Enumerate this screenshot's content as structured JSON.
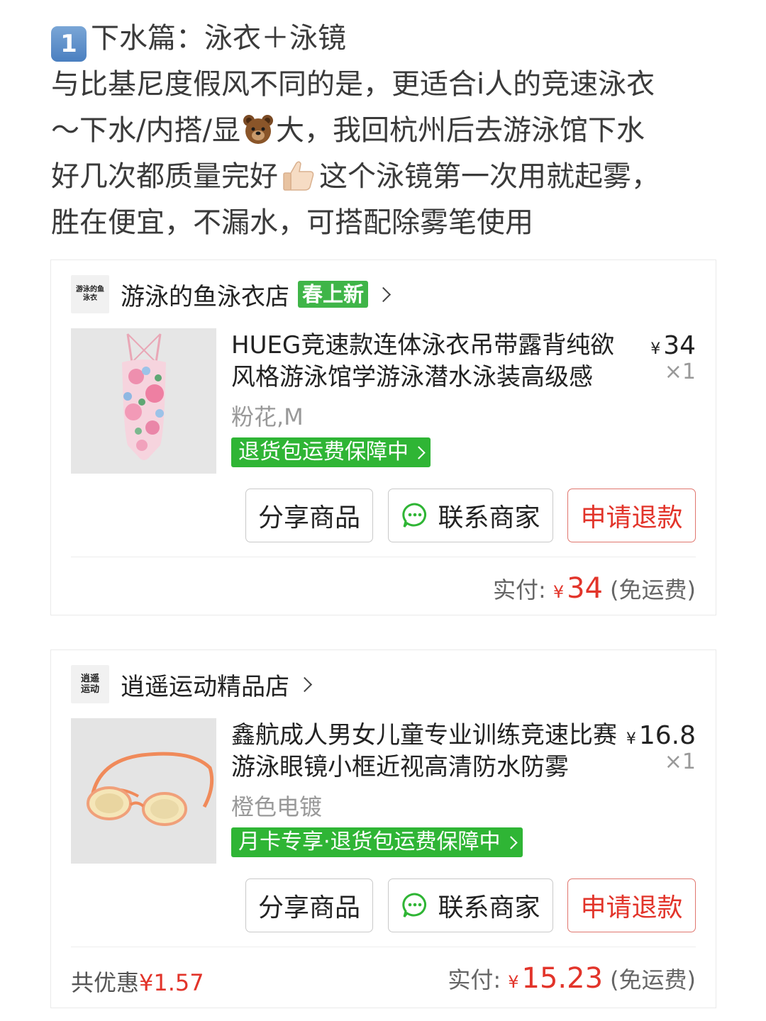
{
  "intro": {
    "badge": "1",
    "line1": "下水篇：泳衣＋泳镜",
    "line2": "与比基尼度假风不同的是，更适合i人的竞速泳衣",
    "line3a": "～下水/内搭/显",
    "line3b": "大，我回杭州后去游泳馆下水",
    "line4a": "好几次都质量完好",
    "line4b": "这个泳镜第一次用就起雾，",
    "line5": "胜在便宜，不漏水，可搭配除雾笔使用",
    "emoji_1": "bear-face-icon",
    "emoji_2": "thumbs-up-icon"
  },
  "orders": [
    {
      "shop_logo_lines": [
        "游泳的鱼",
        "泳衣"
      ],
      "shop_name": "游泳的鱼泳衣店",
      "shop_tag": "春上新",
      "product_title": "HUEG竞速款连体泳衣吊带露背纯欲风格游泳馆学游泳潜水泳装高级感",
      "price_symbol": "¥",
      "price": "34",
      "quantity": "×1",
      "spec": "粉花,M",
      "guarantee": "退货包运费保障中",
      "buttons": {
        "share": "分享商品",
        "contact": "联系商家",
        "refund": "申请退款"
      },
      "total_label": "实付:",
      "total_symbol": "¥",
      "total_amount": "34",
      "shipping": "(免运费)"
    },
    {
      "shop_logo_lines": [
        "逍遥",
        "运动"
      ],
      "shop_name": "逍遥运动精品店",
      "product_title": "鑫航成人男女儿童专业训练竞速比赛游泳眼镜小框近视高清防水防雾",
      "price_symbol": "¥",
      "price": "16.8",
      "quantity": "×1",
      "spec": "橙色电镀",
      "guarantee": "月卡专享·退货包运费保障中",
      "buttons": {
        "share": "分享商品",
        "contact": "联系商家",
        "refund": "申请退款"
      },
      "discount_label": "共优惠",
      "discount_value": "¥1.57",
      "total_label": "实付:",
      "total_symbol": "¥",
      "total_amount": "15.23",
      "shipping": "(免运费)"
    }
  ],
  "colors": {
    "accent_red": "#e2342a",
    "guarantee_green": "#2fb535",
    "tag_green": "#3fb548"
  }
}
